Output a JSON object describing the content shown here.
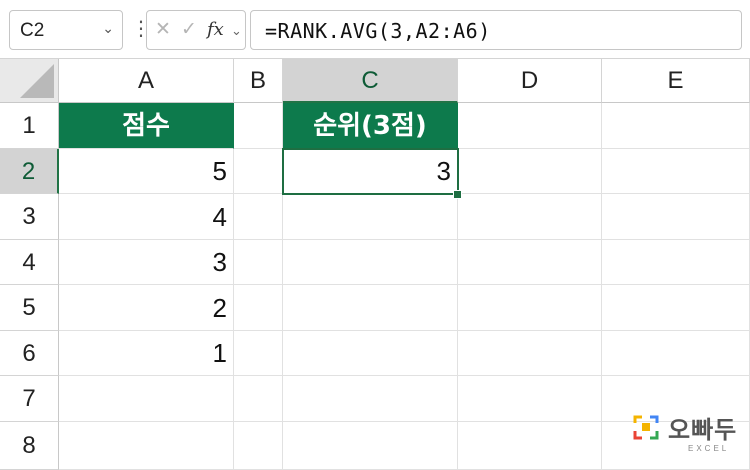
{
  "formula_bar": {
    "name_box": "C2",
    "name_box_arrow": "⌄",
    "kebab": "⋮",
    "cancel_icon": "✕",
    "enter_icon": "✓",
    "fx_label": "fx",
    "fx_arrow": "⌄",
    "formula": "=RANK.AVG(3,A2:A6)"
  },
  "columns": [
    "A",
    "B",
    "C",
    "D",
    "E"
  ],
  "active_column": "C",
  "rows": [
    "1",
    "2",
    "3",
    "4",
    "5",
    "6",
    "7",
    "8"
  ],
  "active_row": "2",
  "cells": {
    "A1": "점수",
    "A2": "5",
    "A3": "4",
    "A4": "3",
    "A5": "2",
    "A6": "1",
    "C1": "순위(3점)",
    "C2": "3"
  },
  "colors": {
    "header_fill": "#0d7a4c",
    "selection": "#1e6e42"
  },
  "logo": {
    "text": "오빠두",
    "sub": "EXCEL"
  }
}
